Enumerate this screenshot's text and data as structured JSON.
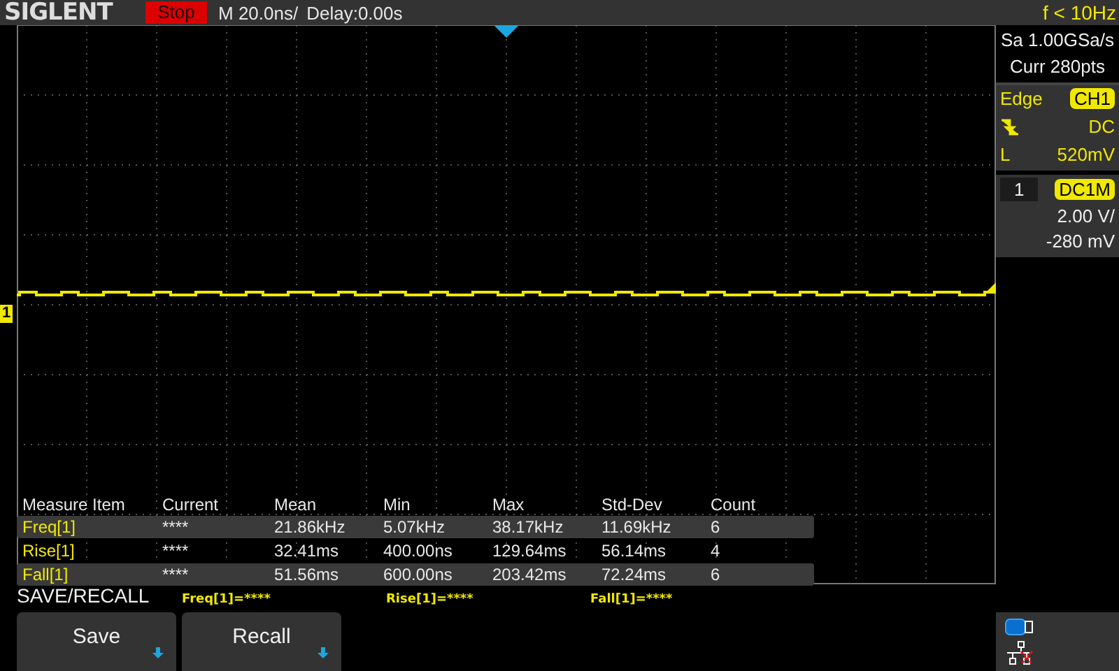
{
  "header": {
    "brand": "SIGLENT",
    "run_state": "Stop",
    "timebase": "M 20.0ns/",
    "delay": "Delay:0.00s",
    "frequency": "f < 10Hz"
  },
  "acquisition": {
    "sample_rate": "Sa 1.00GSa/s",
    "memory": "Curr 280pts"
  },
  "trigger": {
    "type": "Edge",
    "source": "CH1",
    "coupling": "DC",
    "level_label": "L",
    "level_value": "520mV"
  },
  "channel": {
    "number": "1",
    "coupling": "DC1M",
    "scale": "2.00 V/",
    "offset": "-280 mV",
    "marker": "1"
  },
  "measurements": {
    "columns": [
      "Measure Item",
      "Current",
      "Mean",
      "Min",
      "Max",
      "Std-Dev",
      "Count"
    ],
    "rows": [
      {
        "cells": [
          "Freq[1]",
          "****",
          "21.86kHz",
          "5.07kHz",
          "38.17kHz",
          "11.69kHz",
          "6"
        ]
      },
      {
        "cells": [
          "Rise[1]",
          "****",
          "32.41ms",
          "400.00ns",
          "129.64ms",
          "56.14ms",
          "4"
        ]
      },
      {
        "cells": [
          "Fall[1]",
          "****",
          "51.56ms",
          "600.00ns",
          "203.42ms",
          "72.24ms",
          "6"
        ]
      }
    ]
  },
  "summary": [
    "Freq[1]=****",
    "Rise[1]=****",
    "Fall[1]=****"
  ],
  "menu": {
    "title": "SAVE/RECALL",
    "buttons": [
      "Save",
      "Recall"
    ]
  }
}
